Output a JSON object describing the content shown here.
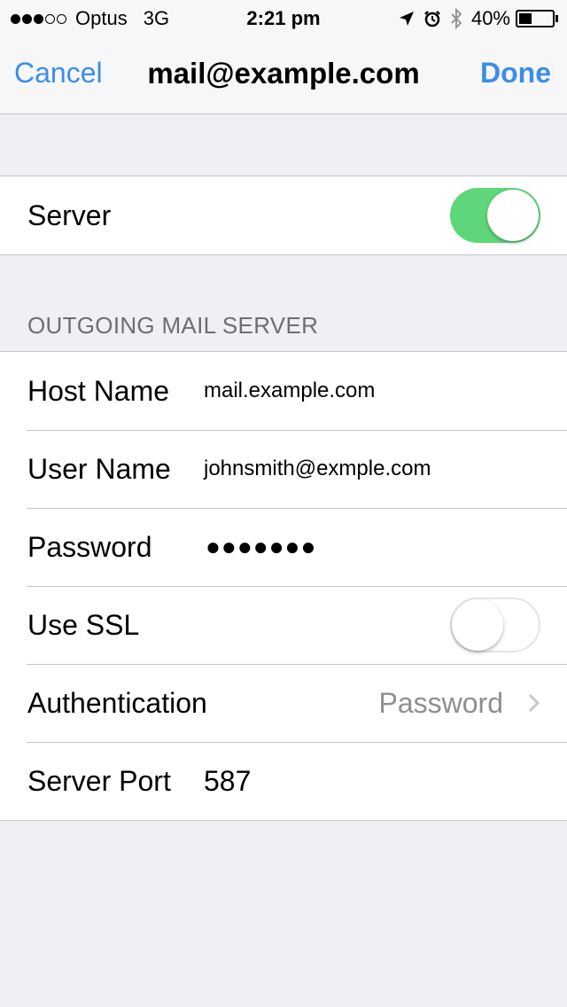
{
  "status_bar": {
    "carrier": "Optus",
    "network": "3G",
    "time": "2:21 pm",
    "battery_percent_label": "40%",
    "battery_level": 0.4,
    "signal_bars_filled": 3,
    "signal_bars_total": 5
  },
  "nav": {
    "cancel_label": "Cancel",
    "title": "mail@example.com",
    "done_label": "Done"
  },
  "server_group": {
    "server_label": "Server",
    "server_enabled": true
  },
  "outgoing": {
    "header": "OUTGOING MAIL SERVER",
    "host_name_label": "Host Name",
    "host_name_value": "mail.example.com",
    "user_name_label": "User Name",
    "user_name_value": "johnsmith@exmple.com",
    "password_label": "Password",
    "password_value": "●●●●●●●",
    "use_ssl_label": "Use SSL",
    "use_ssl_enabled": false,
    "authentication_label": "Authentication",
    "authentication_value": "Password",
    "server_port_label": "Server Port",
    "server_port_value": "587"
  },
  "colors": {
    "accent": "#3b8ee9",
    "toggle_on": "#5ed77a",
    "background": "#efeff4"
  }
}
